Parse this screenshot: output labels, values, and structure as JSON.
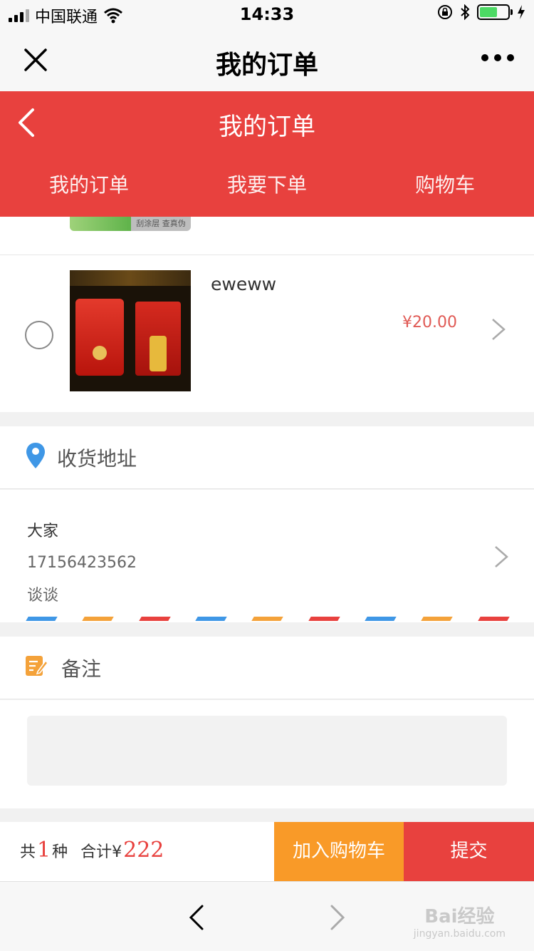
{
  "status_bar": {
    "carrier": "中国联通",
    "time": "14:33",
    "battery_level": 0.62
  },
  "wechat_nav": {
    "title": "我的订单"
  },
  "header": {
    "title": "我的订单",
    "tabs": [
      "我的订单",
      "我要下单",
      "购物车"
    ]
  },
  "prev_item": {
    "card_text": "刮涂层 查真伪"
  },
  "product": {
    "name": "eweww",
    "price": "¥20.00"
  },
  "address": {
    "section_title": "收货地址",
    "name": "大家",
    "phone": "17156423562",
    "detail": "谈谈"
  },
  "note": {
    "section_title": "备注",
    "value": ""
  },
  "footer": {
    "count_prefix": "共",
    "count": "1",
    "count_suffix": "种",
    "total_prefix": "合计¥",
    "total": "222",
    "add_to_cart_label": "加入购物车",
    "submit_label": "提交"
  },
  "watermark": {
    "brand": "Bai经验",
    "url": "jingyan.baidu.com"
  },
  "colors": {
    "primary_red": "#e8413e",
    "cart_orange": "#f99a28",
    "price_red": "#e05a55",
    "pin_blue": "#3f97e6",
    "note_orange": "#f4a23a"
  }
}
